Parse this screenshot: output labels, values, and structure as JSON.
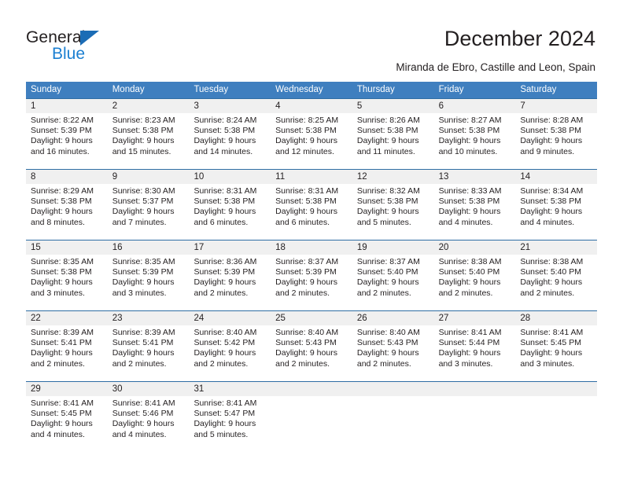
{
  "brand": {
    "name_top": "General",
    "name_bottom": "Blue",
    "color_dark": "#231f20",
    "color_blue": "#1b7fd1",
    "triangle_color": "#1b6cb5"
  },
  "header": {
    "title": "December 2024",
    "subtitle": "Miranda de Ebro, Castille and Leon, Spain"
  },
  "colors": {
    "header_band": "#3f7fbf",
    "week_separator": "#2e6da4",
    "daynum_band": "#f0f0f0",
    "text": "#231f20"
  },
  "weekdays": [
    "Sunday",
    "Monday",
    "Tuesday",
    "Wednesday",
    "Thursday",
    "Friday",
    "Saturday"
  ],
  "weeks": [
    [
      {
        "day": "1",
        "sunrise": "Sunrise: 8:22 AM",
        "sunset": "Sunset: 5:39 PM",
        "daylight1": "Daylight: 9 hours",
        "daylight2": "and 16 minutes."
      },
      {
        "day": "2",
        "sunrise": "Sunrise: 8:23 AM",
        "sunset": "Sunset: 5:38 PM",
        "daylight1": "Daylight: 9 hours",
        "daylight2": "and 15 minutes."
      },
      {
        "day": "3",
        "sunrise": "Sunrise: 8:24 AM",
        "sunset": "Sunset: 5:38 PM",
        "daylight1": "Daylight: 9 hours",
        "daylight2": "and 14 minutes."
      },
      {
        "day": "4",
        "sunrise": "Sunrise: 8:25 AM",
        "sunset": "Sunset: 5:38 PM",
        "daylight1": "Daylight: 9 hours",
        "daylight2": "and 12 minutes."
      },
      {
        "day": "5",
        "sunrise": "Sunrise: 8:26 AM",
        "sunset": "Sunset: 5:38 PM",
        "daylight1": "Daylight: 9 hours",
        "daylight2": "and 11 minutes."
      },
      {
        "day": "6",
        "sunrise": "Sunrise: 8:27 AM",
        "sunset": "Sunset: 5:38 PM",
        "daylight1": "Daylight: 9 hours",
        "daylight2": "and 10 minutes."
      },
      {
        "day": "7",
        "sunrise": "Sunrise: 8:28 AM",
        "sunset": "Sunset: 5:38 PM",
        "daylight1": "Daylight: 9 hours",
        "daylight2": "and 9 minutes."
      }
    ],
    [
      {
        "day": "8",
        "sunrise": "Sunrise: 8:29 AM",
        "sunset": "Sunset: 5:38 PM",
        "daylight1": "Daylight: 9 hours",
        "daylight2": "and 8 minutes."
      },
      {
        "day": "9",
        "sunrise": "Sunrise: 8:30 AM",
        "sunset": "Sunset: 5:37 PM",
        "daylight1": "Daylight: 9 hours",
        "daylight2": "and 7 minutes."
      },
      {
        "day": "10",
        "sunrise": "Sunrise: 8:31 AM",
        "sunset": "Sunset: 5:38 PM",
        "daylight1": "Daylight: 9 hours",
        "daylight2": "and 6 minutes."
      },
      {
        "day": "11",
        "sunrise": "Sunrise: 8:31 AM",
        "sunset": "Sunset: 5:38 PM",
        "daylight1": "Daylight: 9 hours",
        "daylight2": "and 6 minutes."
      },
      {
        "day": "12",
        "sunrise": "Sunrise: 8:32 AM",
        "sunset": "Sunset: 5:38 PM",
        "daylight1": "Daylight: 9 hours",
        "daylight2": "and 5 minutes."
      },
      {
        "day": "13",
        "sunrise": "Sunrise: 8:33 AM",
        "sunset": "Sunset: 5:38 PM",
        "daylight1": "Daylight: 9 hours",
        "daylight2": "and 4 minutes."
      },
      {
        "day": "14",
        "sunrise": "Sunrise: 8:34 AM",
        "sunset": "Sunset: 5:38 PM",
        "daylight1": "Daylight: 9 hours",
        "daylight2": "and 4 minutes."
      }
    ],
    [
      {
        "day": "15",
        "sunrise": "Sunrise: 8:35 AM",
        "sunset": "Sunset: 5:38 PM",
        "daylight1": "Daylight: 9 hours",
        "daylight2": "and 3 minutes."
      },
      {
        "day": "16",
        "sunrise": "Sunrise: 8:35 AM",
        "sunset": "Sunset: 5:39 PM",
        "daylight1": "Daylight: 9 hours",
        "daylight2": "and 3 minutes."
      },
      {
        "day": "17",
        "sunrise": "Sunrise: 8:36 AM",
        "sunset": "Sunset: 5:39 PM",
        "daylight1": "Daylight: 9 hours",
        "daylight2": "and 2 minutes."
      },
      {
        "day": "18",
        "sunrise": "Sunrise: 8:37 AM",
        "sunset": "Sunset: 5:39 PM",
        "daylight1": "Daylight: 9 hours",
        "daylight2": "and 2 minutes."
      },
      {
        "day": "19",
        "sunrise": "Sunrise: 8:37 AM",
        "sunset": "Sunset: 5:40 PM",
        "daylight1": "Daylight: 9 hours",
        "daylight2": "and 2 minutes."
      },
      {
        "day": "20",
        "sunrise": "Sunrise: 8:38 AM",
        "sunset": "Sunset: 5:40 PM",
        "daylight1": "Daylight: 9 hours",
        "daylight2": "and 2 minutes."
      },
      {
        "day": "21",
        "sunrise": "Sunrise: 8:38 AM",
        "sunset": "Sunset: 5:40 PM",
        "daylight1": "Daylight: 9 hours",
        "daylight2": "and 2 minutes."
      }
    ],
    [
      {
        "day": "22",
        "sunrise": "Sunrise: 8:39 AM",
        "sunset": "Sunset: 5:41 PM",
        "daylight1": "Daylight: 9 hours",
        "daylight2": "and 2 minutes."
      },
      {
        "day": "23",
        "sunrise": "Sunrise: 8:39 AM",
        "sunset": "Sunset: 5:41 PM",
        "daylight1": "Daylight: 9 hours",
        "daylight2": "and 2 minutes."
      },
      {
        "day": "24",
        "sunrise": "Sunrise: 8:40 AM",
        "sunset": "Sunset: 5:42 PM",
        "daylight1": "Daylight: 9 hours",
        "daylight2": "and 2 minutes."
      },
      {
        "day": "25",
        "sunrise": "Sunrise: 8:40 AM",
        "sunset": "Sunset: 5:43 PM",
        "daylight1": "Daylight: 9 hours",
        "daylight2": "and 2 minutes."
      },
      {
        "day": "26",
        "sunrise": "Sunrise: 8:40 AM",
        "sunset": "Sunset: 5:43 PM",
        "daylight1": "Daylight: 9 hours",
        "daylight2": "and 2 minutes."
      },
      {
        "day": "27",
        "sunrise": "Sunrise: 8:41 AM",
        "sunset": "Sunset: 5:44 PM",
        "daylight1": "Daylight: 9 hours",
        "daylight2": "and 3 minutes."
      },
      {
        "day": "28",
        "sunrise": "Sunrise: 8:41 AM",
        "sunset": "Sunset: 5:45 PM",
        "daylight1": "Daylight: 9 hours",
        "daylight2": "and 3 minutes."
      }
    ],
    [
      {
        "day": "29",
        "sunrise": "Sunrise: 8:41 AM",
        "sunset": "Sunset: 5:45 PM",
        "daylight1": "Daylight: 9 hours",
        "daylight2": "and 4 minutes."
      },
      {
        "day": "30",
        "sunrise": "Sunrise: 8:41 AM",
        "sunset": "Sunset: 5:46 PM",
        "daylight1": "Daylight: 9 hours",
        "daylight2": "and 4 minutes."
      },
      {
        "day": "31",
        "sunrise": "Sunrise: 8:41 AM",
        "sunset": "Sunset: 5:47 PM",
        "daylight1": "Daylight: 9 hours",
        "daylight2": "and 5 minutes."
      },
      {
        "day": "",
        "sunrise": "",
        "sunset": "",
        "daylight1": "",
        "daylight2": ""
      },
      {
        "day": "",
        "sunrise": "",
        "sunset": "",
        "daylight1": "",
        "daylight2": ""
      },
      {
        "day": "",
        "sunrise": "",
        "sunset": "",
        "daylight1": "",
        "daylight2": ""
      },
      {
        "day": "",
        "sunrise": "",
        "sunset": "",
        "daylight1": "",
        "daylight2": ""
      }
    ]
  ]
}
